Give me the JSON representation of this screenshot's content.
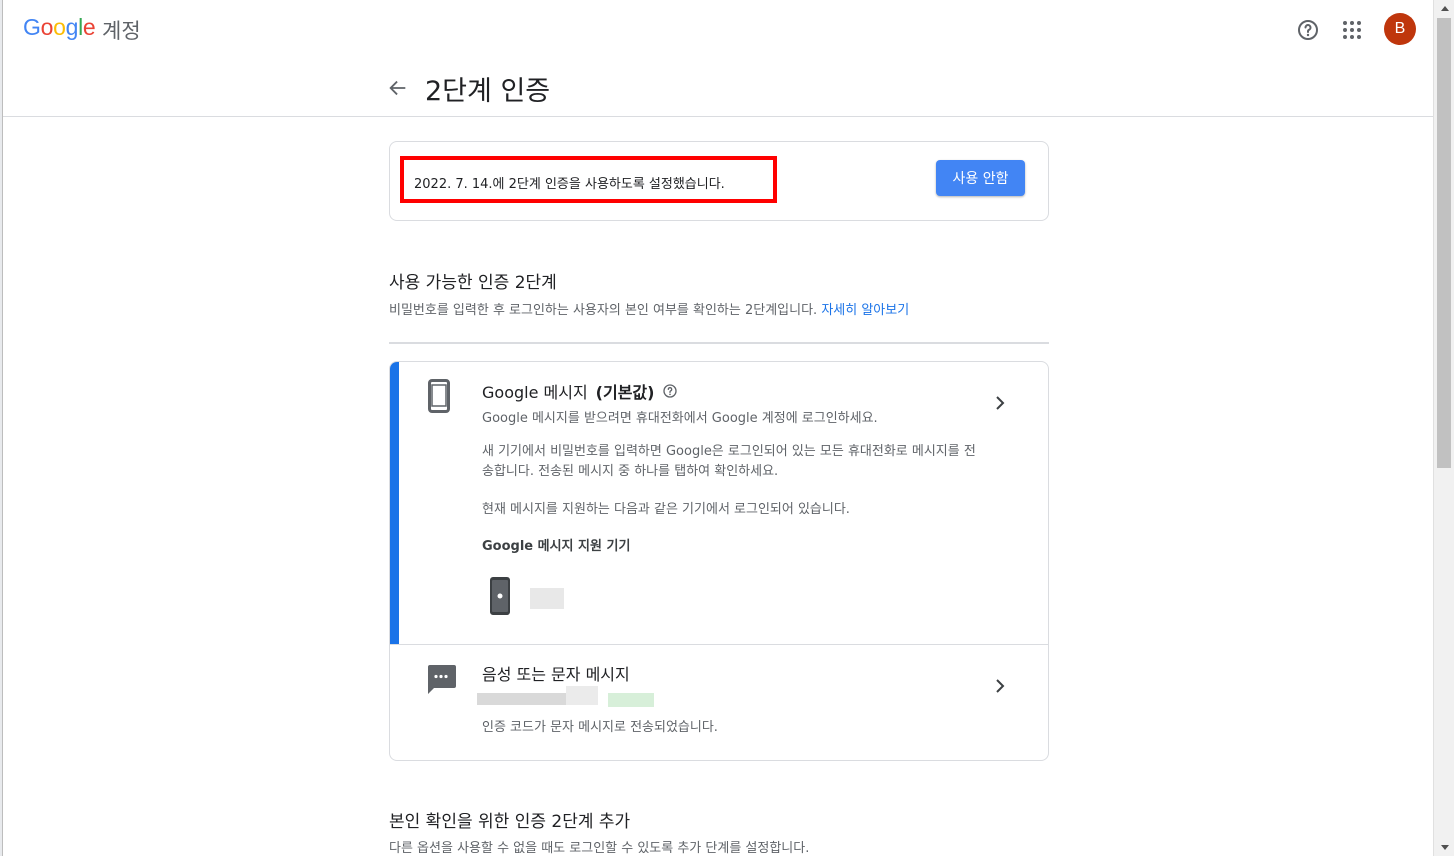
{
  "header": {
    "logo_letters": [
      "G",
      "o",
      "o",
      "g",
      "l",
      "e"
    ],
    "product": "계정",
    "avatar_initial": "B"
  },
  "page": {
    "title": "2단계 인증"
  },
  "status": {
    "text": "2022. 7. 14.에 2단계 인증을 사용하도록 설정했습니다.",
    "disable_label": "사용 안함"
  },
  "available": {
    "title": "사용 가능한 인증 2단계",
    "description": "비밀번호를 입력한 후 로그인하는 사용자의 본인 여부를 확인하는 2단계입니다.",
    "learn_more": "자세히 알아보기"
  },
  "methods": {
    "prompt": {
      "title_prefix": "Google 메시지",
      "title_suffix": "(기본값)",
      "subtitle": "Google 메시지를 받으려면 휴대전화에서 Google 계정에 로그인하세요.",
      "description_1": "새 기기에서 비밀번호를 입력하면 Google은 로그인되어 있는 모든 휴대전화로 메시지를 전송합니다. 전송된 메시지 중 하나를 탭하여 확인하세요.",
      "description_2": "현재 메시지를 지원하는 다음과 같은 기기에서 로그인되어 있습니다.",
      "devices_title": "Google 메시지 지원 기기"
    },
    "sms": {
      "title": "음성 또는 문자 메시지",
      "subtitle": "인증 코드가 문자 메시지로 전송되었습니다."
    }
  },
  "add_step": {
    "title": "본인 확인을 위한 인증 2단계 추가",
    "description": "다른 옵션을 사용할 수 없을 때도 로그인할 수 있도록 추가 단계를 설정합니다."
  },
  "colors": {
    "accent": "#1a73e8",
    "button": "#4285f4",
    "highlight": "#ff0000",
    "avatar": "#bf360c"
  }
}
